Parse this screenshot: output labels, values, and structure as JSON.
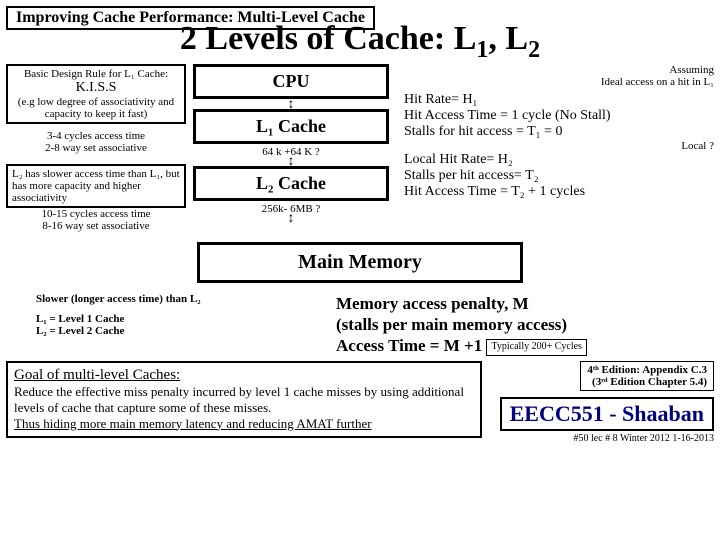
{
  "header": {
    "topic": "Improving Cache Performance:  Multi-Level Cache",
    "title_a": "2 Levels of Cache:  L",
    "title_b": ", L"
  },
  "rule": {
    "line1": "Basic Design Rule for L₁ Cache:",
    "line2": "K.I.S.S",
    "line3": "(e.g low degree of associativity and capacity to keep it fast)"
  },
  "l1note": {
    "a": "3-4 cycles access time",
    "b": "2-8 way set associative"
  },
  "l2side": {
    "a": "L₂ has slower access time than L₁, but has more capacity and higher associativity"
  },
  "l2note": {
    "a": "10-15 cycles access time",
    "b": "8-16 way set associative"
  },
  "blocks": {
    "cpu": "CPU",
    "l1": "L₁ Cache",
    "l2": "L₂ Cache",
    "mm": "Main Memory"
  },
  "between": {
    "l1l2": "64 k +64 K ?",
    "l2mm": "256k- 6MB ?"
  },
  "assume": {
    "a": "Assuming",
    "b": "Ideal access on a hit in L₁"
  },
  "r1": {
    "a": "Hit Rate= H₁",
    "b": "Hit Access Time = 1 cycle (No Stall)",
    "c": "Stalls for hit access = T₁ = 0"
  },
  "localq": "Local ?",
  "r2": {
    "a": "Local Hit Rate= H₂",
    "b": "Stalls per hit access= T₂",
    "c": "Hit Access Time = T₂ + 1 cycles"
  },
  "slower": "Slower (longer access time) than L₂",
  "legend": {
    "a": "L₁  =  Level 1 Cache",
    "b": "L₂  =  Level 2 Cache"
  },
  "penalty": {
    "a": "Memory access penalty, M",
    "b": "(stalls per main memory access)",
    "c": "Access Time = M +1",
    "typ": "Typically 200+ Cycles"
  },
  "goal": {
    "h": "Goal of multi-level Caches:",
    "p1": "Reduce the effective miss penalty incurred by level 1 cache misses by using additional levels of cache that capture some of these misses.",
    "p2": "Thus hiding more main memory latency and reducing AMAT further"
  },
  "ed": {
    "a": "4ᵗʰ Edition: Appendix C.3",
    "b": "(3ʳᵈ Edition Chapter 5.4)"
  },
  "course": "EECC551 - Shaaban",
  "foot": "#50  lec # 8    Winter 2012   1-16-2013"
}
